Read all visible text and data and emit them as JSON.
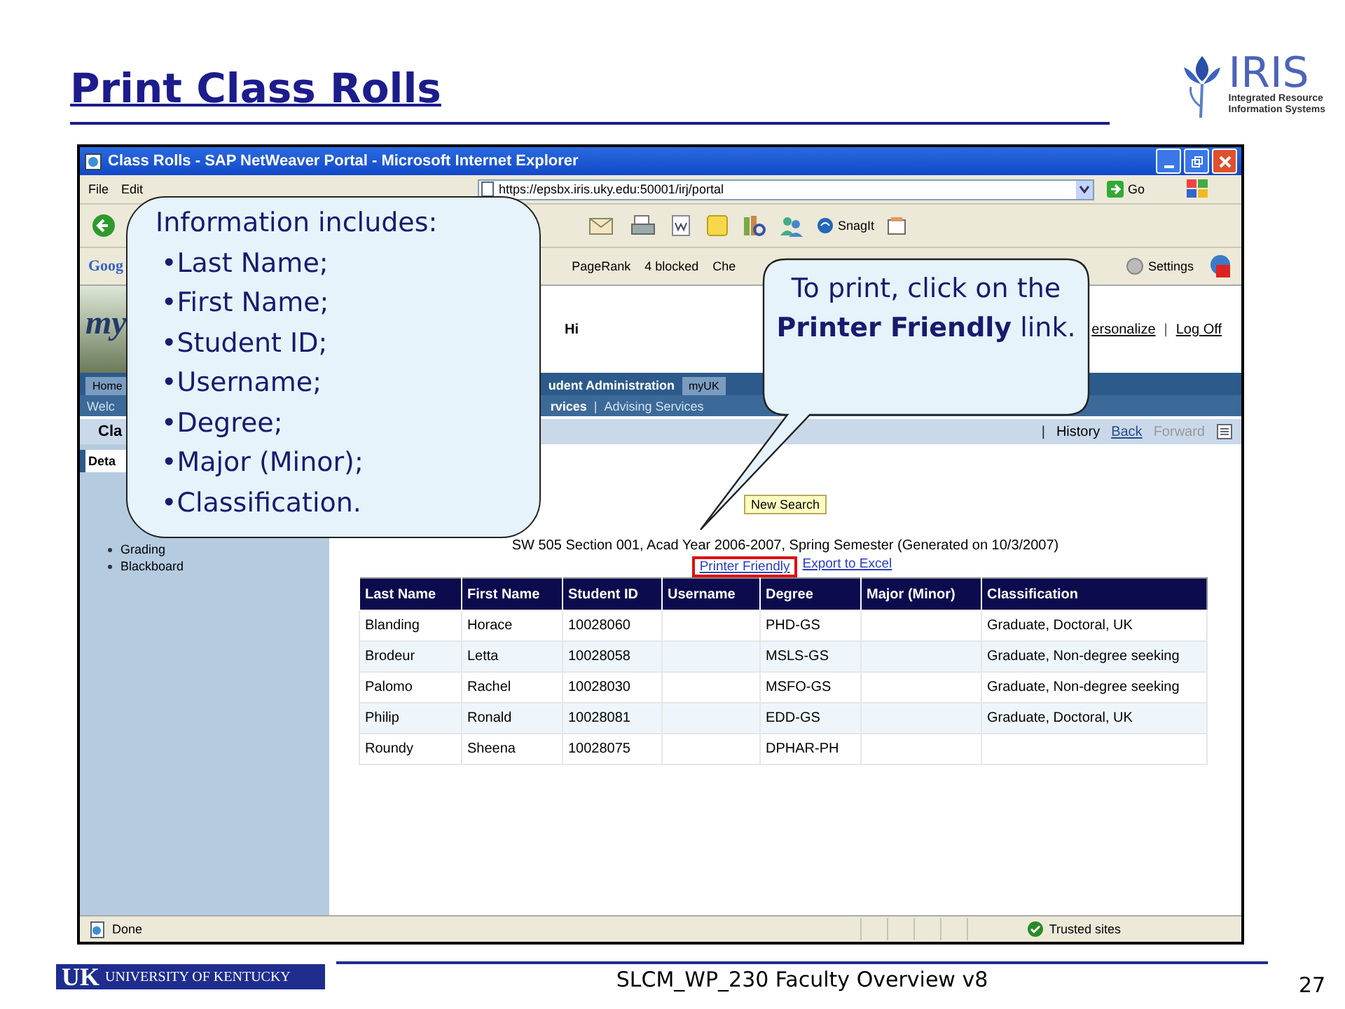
{
  "slide": {
    "title": "Print Class Rolls",
    "footer": "SLCM_WP_230 Faculty Overview v8",
    "page_number": "27"
  },
  "logos": {
    "brand": "IRIS",
    "brand_subtitle": [
      "Integrated Resource",
      "Information Systems"
    ],
    "university_mark": "UK",
    "university_name": "UNIVERSITY OF KENTUCKY"
  },
  "browser": {
    "title": "Class Rolls - SAP NetWeaver Portal - Microsoft Internet Explorer",
    "menu": [
      "File",
      "Edit"
    ],
    "address": "https://epsbx.iris.uky.edu:50001/irj/portal",
    "go_button": "Go",
    "toolbar_label": "SnagIt",
    "google_bar": {
      "logo": "Goog",
      "items": [
        "PageRank",
        "4 blocked",
        "Che"
      ],
      "settings": "Settings"
    },
    "status": "Done",
    "zone": "Trusted sites"
  },
  "portal": {
    "logo": "my",
    "greeting": "Hi",
    "separator": "|",
    "header_links": [
      "ersonalize",
      "Log Off"
    ],
    "tabs": [
      {
        "label": "Home",
        "selected": false
      },
      {
        "label": "udent Administration",
        "selected": true
      },
      {
        "label": "myUK",
        "selected": false
      }
    ],
    "subnav": [
      {
        "label": "Welc",
        "selected": false
      },
      {
        "label": "rvices",
        "selected": true
      },
      {
        "label": "Advising Services",
        "selected": false
      }
    ],
    "page_title": "Cla",
    "history_links": [
      {
        "label": "History",
        "disabled": false
      },
      {
        "label": "Back",
        "disabled": false
      },
      {
        "label": "Forward",
        "disabled": true
      }
    ],
    "detail_tab": "Deta",
    "nav_items": [
      "Grading",
      "Blackboard"
    ]
  },
  "report": {
    "button": "New Search",
    "caption": "SW 505 Section 001, Acad Year 2006-2007, Spring Semester (Generated on 10/3/2007)",
    "links": [
      {
        "label": "Printer Friendly",
        "highlighted": true
      },
      {
        "label": "Export to Excel",
        "highlighted": false
      }
    ],
    "table": {
      "columns": [
        "Last Name",
        "First Name",
        "Student ID",
        "Username",
        "Degree",
        "Major (Minor)",
        "Classification"
      ],
      "rows": [
        [
          "Blanding",
          "Horace",
          "10028060",
          "",
          "PHD-GS",
          "",
          "Graduate, Doctoral, UK"
        ],
        [
          "Brodeur",
          "Letta",
          "10028058",
          "",
          "MSLS-GS",
          "",
          "Graduate, Non-degree seeking"
        ],
        [
          "Palomo",
          "Rachel",
          "10028030",
          "",
          "MSFO-GS",
          "",
          "Graduate, Non-degree seeking"
        ],
        [
          "Philip",
          "Ronald",
          "10028081",
          "",
          "EDD-GS",
          "",
          "Graduate, Doctoral, UK"
        ],
        [
          "Roundy",
          "Sheena",
          "10028075",
          "",
          "DPHAR-PH",
          "",
          ""
        ]
      ]
    }
  },
  "callouts": [
    {
      "kind": "list",
      "heading": "Information includes:",
      "items": [
        "•Last Name;",
        "•First Name;",
        "•Student ID;",
        "•Username;",
        "•Degree;",
        "•Major (Minor);",
        "•Classification."
      ]
    },
    {
      "kind": "pointer",
      "text": "To print, click on the **Printer Friendly** link."
    }
  ]
}
